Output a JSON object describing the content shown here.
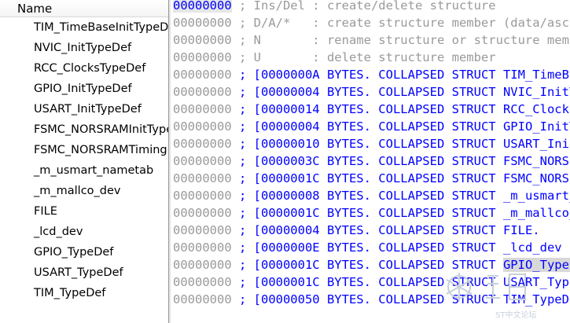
{
  "sidebar": {
    "header": "Name",
    "items": [
      "TIM_TimeBaseInitTypeDef",
      "NVIC_InitTypeDef",
      "RCC_ClocksTypeDef",
      "GPIO_InitTypeDef",
      "USART_InitTypeDef",
      "FSMC_NORSRAMInitTypeDef",
      "FSMC_NORSRAMTimingInitTypeDef",
      "_m_usmart_nametab",
      "_m_mallco_dev",
      "FILE",
      "_lcd_dev",
      "GPIO_TypeDef",
      "USART_TypeDef",
      "TIM_TypeDef"
    ]
  },
  "code": {
    "help_lines": [
      {
        "addr": "00000000",
        "text": " ; Ins/Del : create/delete structure"
      },
      {
        "addr": "00000000",
        "text": " ; D/A/*   : create structure member (data/ascii/array)"
      },
      {
        "addr": "00000000",
        "text": " ; N       : rename structure or structure member"
      },
      {
        "addr": "00000000",
        "text": " ; U       : delete structure member"
      }
    ],
    "struct_lines": [
      {
        "addr": "00000000",
        "size": "0000000A",
        "name": "TIM_TimeBaseInitTypeDef"
      },
      {
        "addr": "00000000",
        "size": "00000004",
        "name": "NVIC_InitTypeDef"
      },
      {
        "addr": "00000000",
        "size": "00000014",
        "name": "RCC_ClocksTypeDef"
      },
      {
        "addr": "00000000",
        "size": "00000004",
        "name": "GPIO_InitTypeDef"
      },
      {
        "addr": "00000000",
        "size": "00000010",
        "name": "USART_InitTypeDef"
      },
      {
        "addr": "00000000",
        "size": "0000003C",
        "name": "FSMC_NORSRAMInitTypeDef"
      },
      {
        "addr": "00000000",
        "size": "0000001C",
        "name": "FSMC_NORSRAMTimingInitTypeDef"
      },
      {
        "addr": "00000000",
        "size": "00000008",
        "name": "_m_usmart_nametab"
      },
      {
        "addr": "00000000",
        "size": "0000001C",
        "name": "_m_mallco_dev"
      },
      {
        "addr": "00000000",
        "size": "00000004",
        "name": "FILE."
      },
      {
        "addr": "00000000",
        "size": "0000000E",
        "name": "_lcd_dev"
      },
      {
        "addr": "00000000",
        "size": "0000001C",
        "name": "GPIO_TypeDef"
      },
      {
        "addr": "00000000",
        "size": "0000001C",
        "name": "USART_TypeDef"
      },
      {
        "addr": "00000000",
        "size": "00000050",
        "name": "TIM_TypeDef"
      }
    ],
    "bytes_word": " BYTES.",
    "collapsed_word": " COLLAPSED",
    "struct_word": " STRUCT "
  },
  "watermark": {
    "text": "ST中文论坛"
  },
  "colors": {
    "keyword": "#0000ff",
    "comment": "#9a9a9a",
    "selection": "#d8d8d8"
  }
}
